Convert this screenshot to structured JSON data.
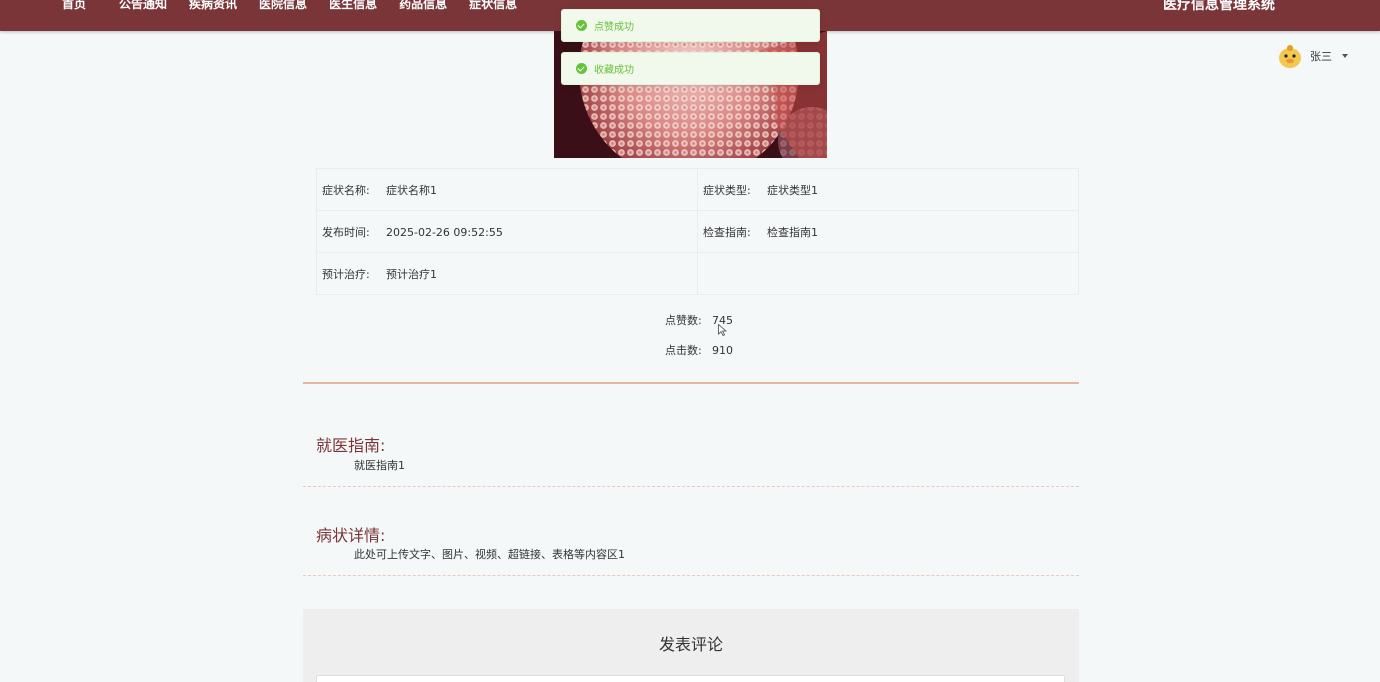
{
  "nav": {
    "items": [
      "首页",
      "公告通知",
      "疾病资讯",
      "医院信息",
      "医生信息",
      "药品信息",
      "症状信息"
    ],
    "site_title": "医疗信息管理系统"
  },
  "user": {
    "name": "张三"
  },
  "toasts": [
    {
      "message": "点赞成功",
      "type": "success"
    },
    {
      "message": "收藏成功",
      "type": "success"
    }
  ],
  "details": {
    "symptom_name_label": "症状名称:",
    "symptom_name": "症状名称1",
    "symptom_type_label": "症状类型:",
    "symptom_type": "症状类型1",
    "publish_time_label": "发布时间:",
    "publish_time": "2025-02-26 09:52:55",
    "check_guide_label": "检查指南:",
    "check_guide": "检查指南1",
    "treatment_label": "预计治疗:",
    "treatment": "预计治疗1"
  },
  "stats": {
    "likes_label": "点赞数:",
    "likes": "745",
    "clicks_label": "点击数:",
    "clicks": "910"
  },
  "sections": {
    "guide_title": "就医指南:",
    "guide_body": "就医指南1",
    "detail_title": "病状详情:",
    "detail_body": "此处可上传文字、图片、视频、超链接、表格等内容区1"
  },
  "comment": {
    "title": "发表评论"
  },
  "colors": {
    "primary": "#7a3538",
    "success": "#67c23a",
    "divider": "#e5b69c"
  }
}
